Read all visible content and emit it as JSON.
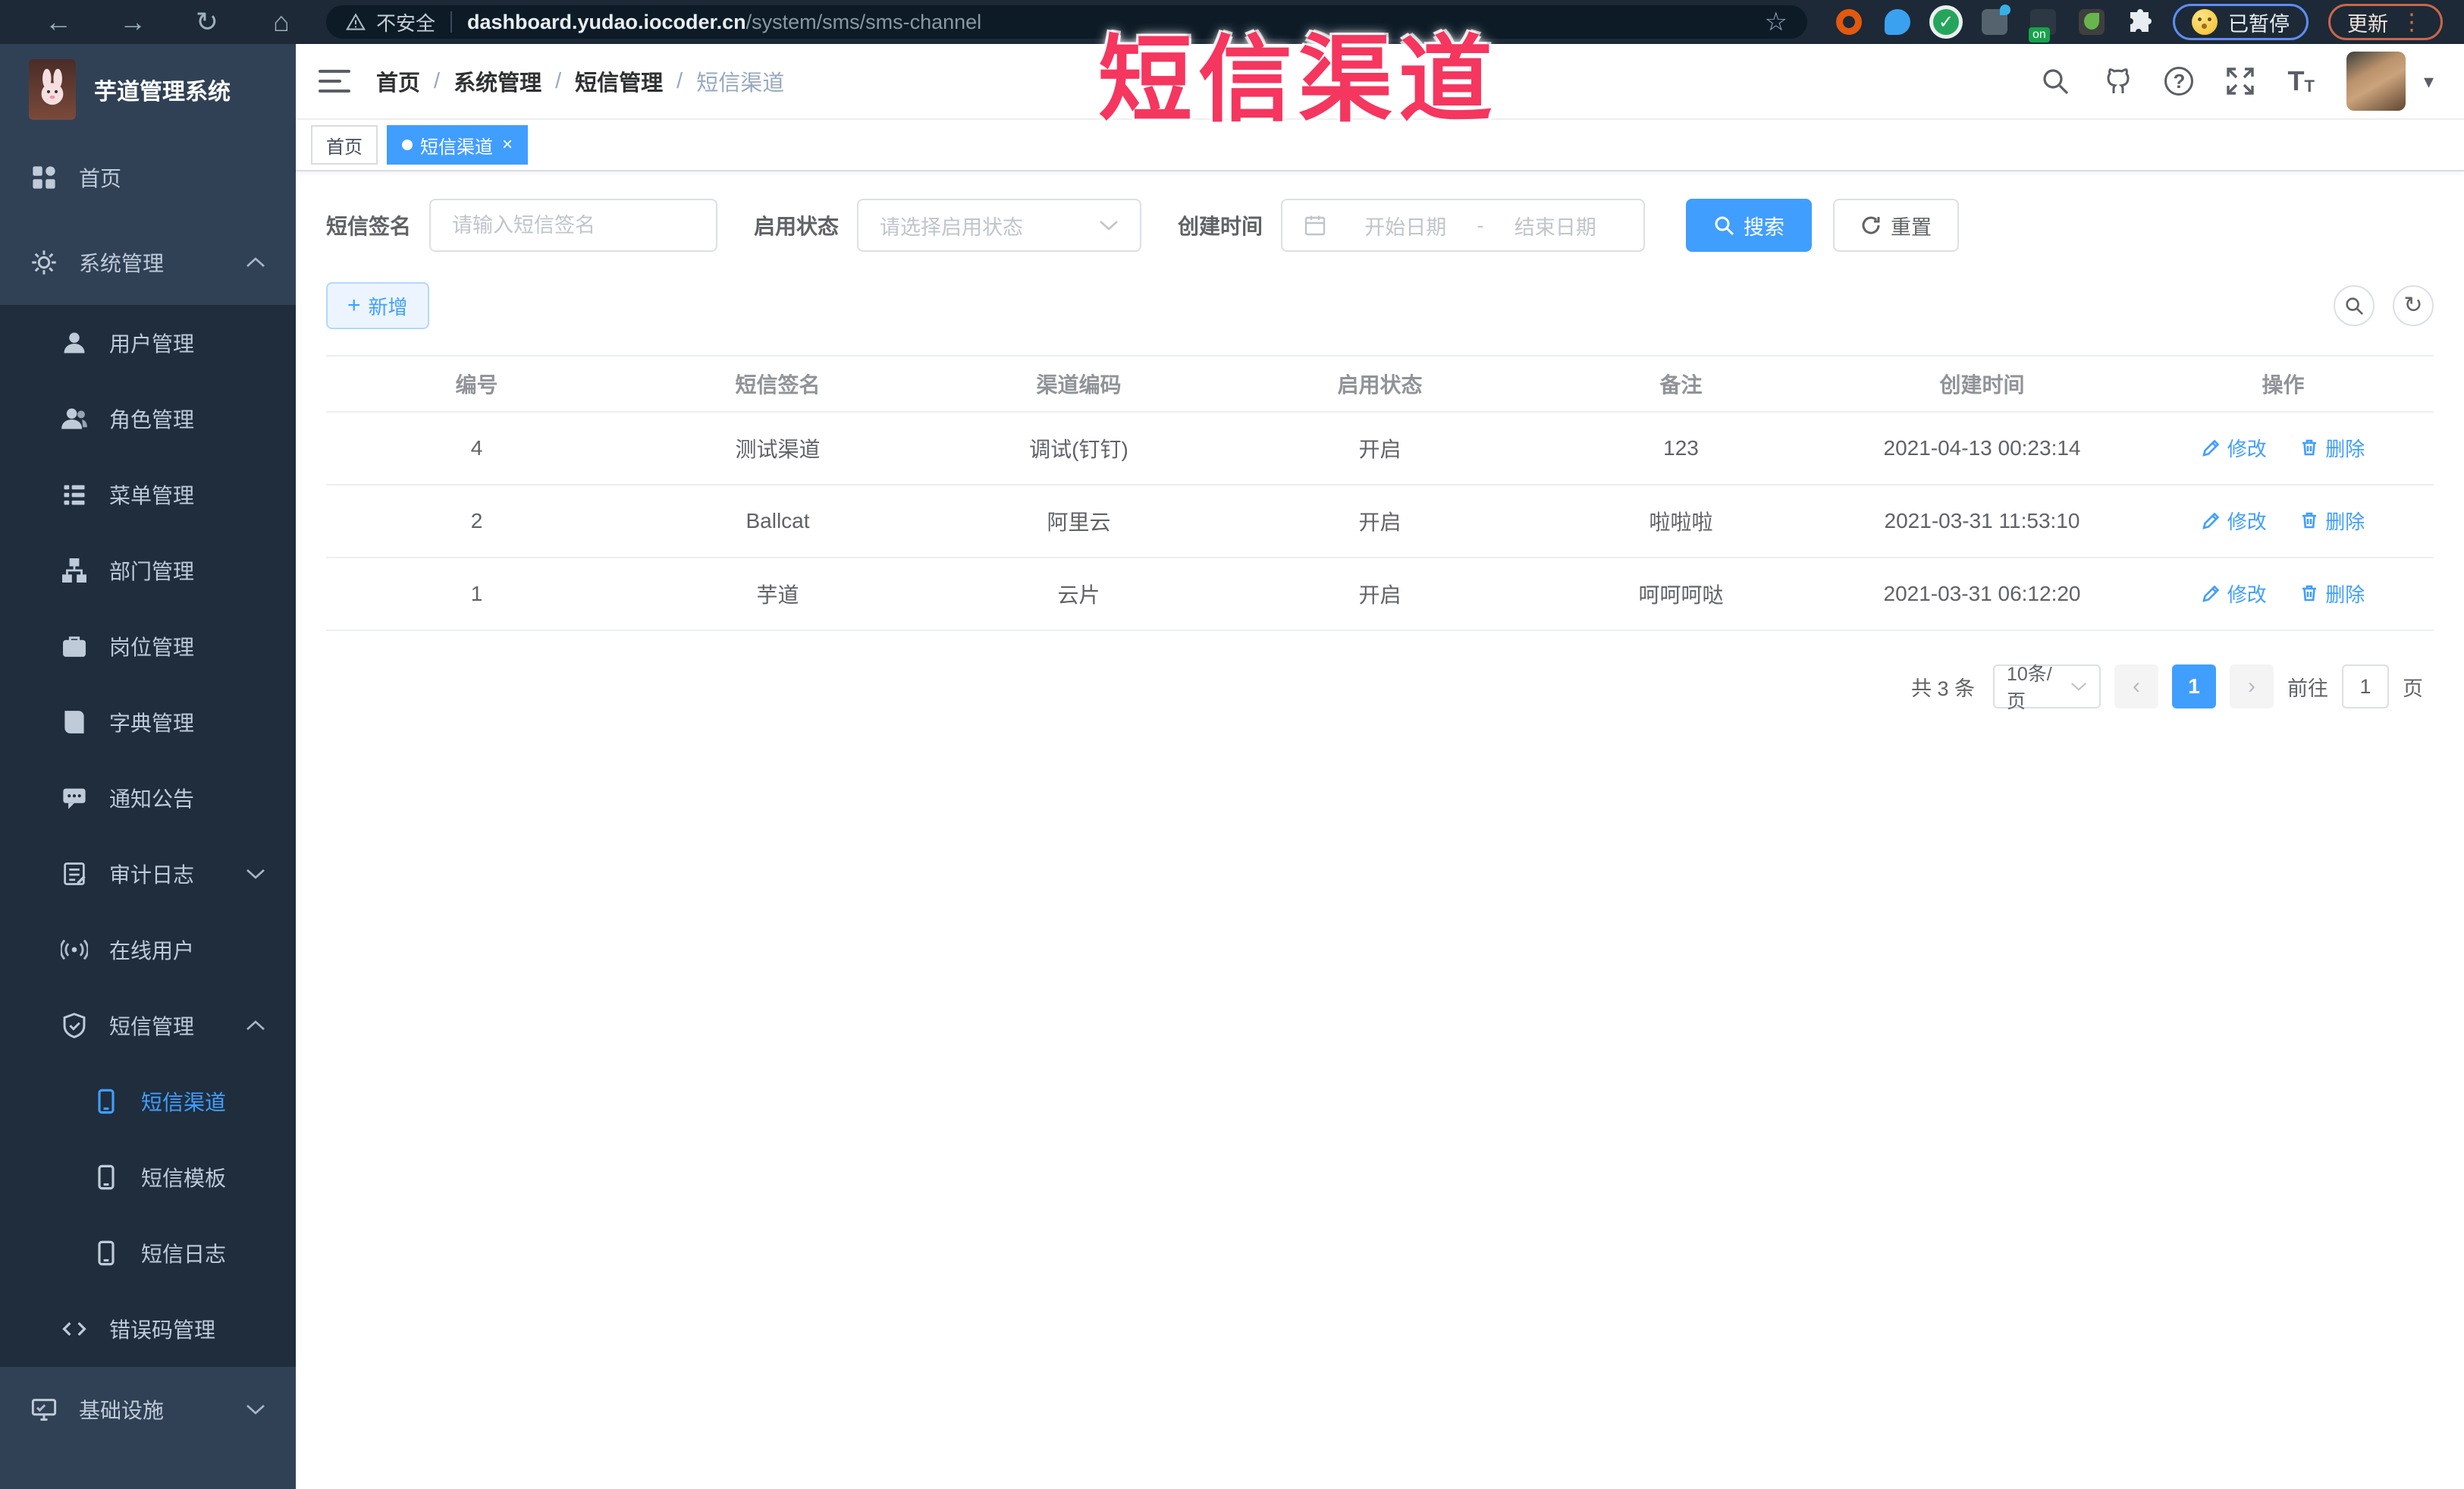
{
  "browser": {
    "security_label": "不安全",
    "url_host": "dashboard.yudao.iocoder.cn",
    "url_path": "/system/sms/sms-channel",
    "on_badge": "on",
    "paused_label": "已暂停",
    "update_label": "更新"
  },
  "icons": {
    "back": "←",
    "forward": "→",
    "reload": "↻",
    "home": "⌂",
    "star": "☆",
    "check": "✓",
    "kebab": "⋮",
    "question": "?",
    "caret_down": "▾",
    "close": "×",
    "plus": "+",
    "refresh": "↻",
    "prev": "‹",
    "next": "›",
    "font_large": "T",
    "font_small": "T"
  },
  "watermark": {
    "text": "短信渠道"
  },
  "sidebar": {
    "logo_title": "芋道管理系统",
    "items": [
      {
        "label": "首页"
      },
      {
        "label": "系统管理"
      },
      {
        "label": "用户管理"
      },
      {
        "label": "角色管理"
      },
      {
        "label": "菜单管理"
      },
      {
        "label": "部门管理"
      },
      {
        "label": "岗位管理"
      },
      {
        "label": "字典管理"
      },
      {
        "label": "通知公告"
      },
      {
        "label": "审计日志"
      },
      {
        "label": "在线用户"
      },
      {
        "label": "短信管理"
      },
      {
        "label": "短信渠道"
      },
      {
        "label": "短信模板"
      },
      {
        "label": "短信日志"
      },
      {
        "label": "错误码管理"
      },
      {
        "label": "基础设施"
      }
    ]
  },
  "header": {
    "breadcrumb": [
      "首页",
      "系统管理",
      "短信管理",
      "短信渠道"
    ],
    "separator": "/"
  },
  "tabs": [
    {
      "label": "首页"
    },
    {
      "label": "短信渠道"
    }
  ],
  "filters": {
    "sign_label": "短信签名",
    "sign_placeholder": "请输入短信签名",
    "status_label": "启用状态",
    "status_placeholder": "请选择启用状态",
    "time_label": "创建时间",
    "start_placeholder": "开始日期",
    "range_separator": "-",
    "end_placeholder": "结束日期",
    "search_label": "搜索",
    "reset_label": "重置"
  },
  "toolbar": {
    "add_label": "新增"
  },
  "table": {
    "columns": [
      "编号",
      "短信签名",
      "渠道编码",
      "启用状态",
      "备注",
      "创建时间",
      "操作"
    ],
    "edit_label": "修改",
    "delete_label": "删除",
    "rows": [
      {
        "id": "4",
        "sign": "测试渠道",
        "code": "调试(钉钉)",
        "status": "开启",
        "remark": "123",
        "created": "2021-04-13 00:23:14"
      },
      {
        "id": "2",
        "sign": "Ballcat",
        "code": "阿里云",
        "status": "开启",
        "remark": "啦啦啦",
        "created": "2021-03-31 11:53:10"
      },
      {
        "id": "1",
        "sign": "芋道",
        "code": "云片",
        "status": "开启",
        "remark": "呵呵呵哒",
        "created": "2021-03-31 06:12:20"
      }
    ]
  },
  "pagination": {
    "total": "共 3 条",
    "page_size": "10条/页",
    "current": "1",
    "goto_label": "前往",
    "goto_value": "1",
    "page_unit": "页"
  },
  "colors": {
    "primary": "#409eff",
    "watermark": "#f5365f",
    "sidebar": "#304156",
    "submenu": "#1f2d3d"
  }
}
